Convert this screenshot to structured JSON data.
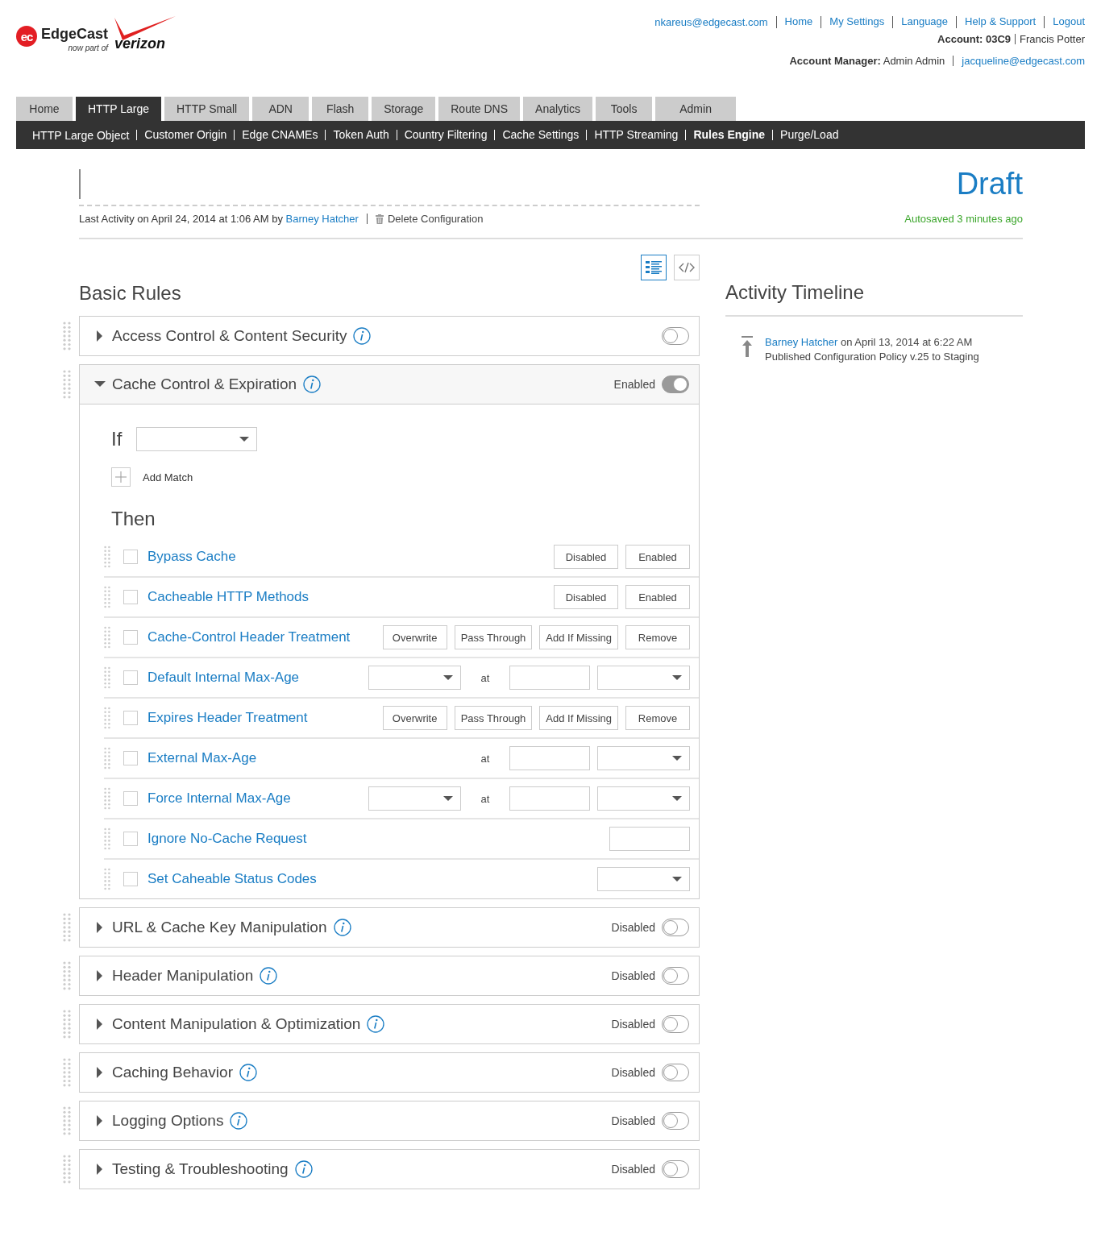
{
  "logo": {
    "badge": "ec",
    "name": "EdgeCast",
    "tagline": "now part of",
    "partner": "verizon"
  },
  "top_links": [
    "nkareus@edgecast.com",
    "Home",
    "My Settings",
    "Language",
    "Help & Support",
    "Logout"
  ],
  "account": {
    "label": "Account: 03C9",
    "name": "Francis Potter"
  },
  "account_manager": {
    "text": "**Account Manager:** Admin Admin",
    "email": "jacqueline@edgecast.com"
  },
  "tabs": [
    {
      "label": "Home",
      "selected": false
    },
    {
      "label": "HTTP Large",
      "selected": true
    },
    {
      "label": "HTTP Small",
      "selected": false
    },
    {
      "label": "ADN",
      "selected": false
    },
    {
      "label": "Flash",
      "selected": false
    },
    {
      "label": "Storage",
      "selected": false
    },
    {
      "label": "Route DNS",
      "selected": false
    },
    {
      "label": "Analytics",
      "selected": false
    },
    {
      "label": "Tools",
      "selected": false
    },
    {
      "label": "Admin",
      "selected": false
    }
  ],
  "subnav": [
    {
      "label": "HTTP Large Object",
      "selected": false
    },
    {
      "label": "Customer Origin",
      "selected": false
    },
    {
      "label": "Edge CNAMEs",
      "selected": false
    },
    {
      "label": "Token Auth",
      "selected": false
    },
    {
      "label": "Country Filtering",
      "selected": false
    },
    {
      "label": "Cache Settings",
      "selected": false
    },
    {
      "label": "HTTP Streaming",
      "selected": false
    },
    {
      "label": "Rules Engine",
      "selected": true
    },
    {
      "label": "Purge/Load",
      "selected": false
    }
  ],
  "status": "Draft",
  "autosaved": "Autosaved 3 minutes ago",
  "last_activity": {
    "text": "Last Activity on April 24, 2014 at 1:06 AM by",
    "user": "Barney Hatcher",
    "delete": "Delete Configuration"
  },
  "view_modes": [
    {
      "kind": "list",
      "selected": true
    },
    {
      "kind": "code",
      "selected": false
    }
  ],
  "basic_rules": {
    "title": "Basic Rules",
    "sections": [
      {
        "title": "Access Control & Content Security",
        "expanded": false,
        "on": false
      },
      {
        "title": "Cache Control & Expiration",
        "expanded": true,
        "on": true,
        "status": "Enabled",
        "if_label": "If",
        "add_match": "Add Match",
        "then_label": "Then",
        "rules": [
          {
            "label": "Bypass Cache",
            "checked": false,
            "controls": [
              {
                "kind": "button",
                "label": "Disabled"
              },
              {
                "kind": "button",
                "label": "Enabled"
              }
            ]
          },
          {
            "label": "Cacheable HTTP Methods",
            "checked": false,
            "controls": [
              {
                "kind": "button",
                "label": "Disabled"
              },
              {
                "kind": "button",
                "label": "Enabled"
              }
            ]
          },
          {
            "label": "Cache-Control Header Treatment",
            "checked": false,
            "controls": [
              {
                "kind": "button",
                "label": "Overwrite"
              },
              {
                "kind": "button",
                "label": "Pass Through"
              },
              {
                "kind": "button",
                "label": "Add If Missing"
              },
              {
                "kind": "button",
                "label": "Remove"
              }
            ]
          },
          {
            "label": "Default Internal Max-Age",
            "checked": false,
            "controls": [
              {
                "kind": "select"
              },
              {
                "kind": "text",
                "label": "at"
              },
              {
                "kind": "input"
              },
              {
                "kind": "select"
              }
            ]
          },
          {
            "label": "Expires Header Treatment",
            "checked": false,
            "controls": [
              {
                "kind": "button",
                "label": "Overwrite"
              },
              {
                "kind": "button",
                "label": "Pass Through"
              },
              {
                "kind": "button",
                "label": "Add If Missing"
              },
              {
                "kind": "button",
                "label": "Remove"
              }
            ]
          },
          {
            "label": "External Max-Age",
            "checked": false,
            "controls": [
              {
                "kind": "text",
                "label": "at"
              },
              {
                "kind": "input"
              },
              {
                "kind": "select"
              }
            ]
          },
          {
            "label": "Force Internal Max-Age",
            "checked": false,
            "controls": [
              {
                "kind": "select"
              },
              {
                "kind": "text",
                "label": "at"
              },
              {
                "kind": "input"
              },
              {
                "kind": "select"
              }
            ]
          },
          {
            "label": "Ignore No-Cache Request",
            "checked": false,
            "controls": [
              {
                "kind": "input"
              }
            ]
          },
          {
            "label": "Set Caheable Status Codes",
            "checked": false,
            "controls": [
              {
                "kind": "select"
              }
            ]
          }
        ]
      },
      {
        "title": "URL & Cache Key Manipulation",
        "expanded": false,
        "on": false,
        "status": "Disabled"
      },
      {
        "title": "Header Manipulation",
        "expanded": false,
        "on": false,
        "status": "Disabled"
      },
      {
        "title": "Content Manipulation & Optimization",
        "expanded": false,
        "on": false,
        "status": "Disabled"
      },
      {
        "title": "Caching Behavior",
        "expanded": false,
        "on": false,
        "status": "Disabled"
      },
      {
        "title": "Logging Options",
        "expanded": false,
        "on": false,
        "status": "Disabled"
      },
      {
        "title": "Testing & Troubleshooting",
        "expanded": false,
        "on": false,
        "status": "Disabled"
      }
    ]
  },
  "activity_timeline": {
    "title": "Activity Timeline",
    "entries": [
      {
        "user": "Barney Hatcher",
        "when": "on April 13, 2014 at 6:22 AM",
        "action": "Published Configuration Policy v.25 to Staging"
      }
    ]
  }
}
